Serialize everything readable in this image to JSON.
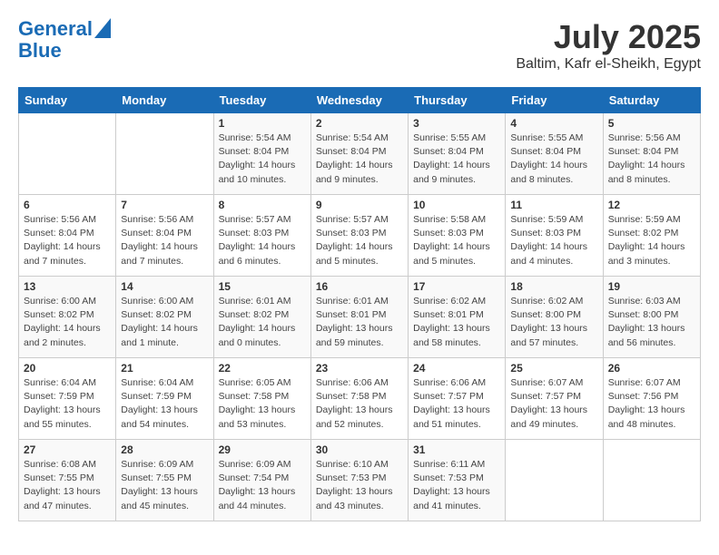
{
  "header": {
    "logo_line1": "General",
    "logo_line2": "Blue",
    "month": "July 2025",
    "location": "Baltim, Kafr el-Sheikh, Egypt"
  },
  "days_of_week": [
    "Sunday",
    "Monday",
    "Tuesday",
    "Wednesday",
    "Thursday",
    "Friday",
    "Saturday"
  ],
  "weeks": [
    [
      {
        "day": "",
        "info": ""
      },
      {
        "day": "",
        "info": ""
      },
      {
        "day": "1",
        "info": "Sunrise: 5:54 AM\nSunset: 8:04 PM\nDaylight: 14 hours\nand 10 minutes."
      },
      {
        "day": "2",
        "info": "Sunrise: 5:54 AM\nSunset: 8:04 PM\nDaylight: 14 hours\nand 9 minutes."
      },
      {
        "day": "3",
        "info": "Sunrise: 5:55 AM\nSunset: 8:04 PM\nDaylight: 14 hours\nand 9 minutes."
      },
      {
        "day": "4",
        "info": "Sunrise: 5:55 AM\nSunset: 8:04 PM\nDaylight: 14 hours\nand 8 minutes."
      },
      {
        "day": "5",
        "info": "Sunrise: 5:56 AM\nSunset: 8:04 PM\nDaylight: 14 hours\nand 8 minutes."
      }
    ],
    [
      {
        "day": "6",
        "info": "Sunrise: 5:56 AM\nSunset: 8:04 PM\nDaylight: 14 hours\nand 7 minutes."
      },
      {
        "day": "7",
        "info": "Sunrise: 5:56 AM\nSunset: 8:04 PM\nDaylight: 14 hours\nand 7 minutes."
      },
      {
        "day": "8",
        "info": "Sunrise: 5:57 AM\nSunset: 8:03 PM\nDaylight: 14 hours\nand 6 minutes."
      },
      {
        "day": "9",
        "info": "Sunrise: 5:57 AM\nSunset: 8:03 PM\nDaylight: 14 hours\nand 5 minutes."
      },
      {
        "day": "10",
        "info": "Sunrise: 5:58 AM\nSunset: 8:03 PM\nDaylight: 14 hours\nand 5 minutes."
      },
      {
        "day": "11",
        "info": "Sunrise: 5:59 AM\nSunset: 8:03 PM\nDaylight: 14 hours\nand 4 minutes."
      },
      {
        "day": "12",
        "info": "Sunrise: 5:59 AM\nSunset: 8:02 PM\nDaylight: 14 hours\nand 3 minutes."
      }
    ],
    [
      {
        "day": "13",
        "info": "Sunrise: 6:00 AM\nSunset: 8:02 PM\nDaylight: 14 hours\nand 2 minutes."
      },
      {
        "day": "14",
        "info": "Sunrise: 6:00 AM\nSunset: 8:02 PM\nDaylight: 14 hours\nand 1 minute."
      },
      {
        "day": "15",
        "info": "Sunrise: 6:01 AM\nSunset: 8:02 PM\nDaylight: 14 hours\nand 0 minutes."
      },
      {
        "day": "16",
        "info": "Sunrise: 6:01 AM\nSunset: 8:01 PM\nDaylight: 13 hours\nand 59 minutes."
      },
      {
        "day": "17",
        "info": "Sunrise: 6:02 AM\nSunset: 8:01 PM\nDaylight: 13 hours\nand 58 minutes."
      },
      {
        "day": "18",
        "info": "Sunrise: 6:02 AM\nSunset: 8:00 PM\nDaylight: 13 hours\nand 57 minutes."
      },
      {
        "day": "19",
        "info": "Sunrise: 6:03 AM\nSunset: 8:00 PM\nDaylight: 13 hours\nand 56 minutes."
      }
    ],
    [
      {
        "day": "20",
        "info": "Sunrise: 6:04 AM\nSunset: 7:59 PM\nDaylight: 13 hours\nand 55 minutes."
      },
      {
        "day": "21",
        "info": "Sunrise: 6:04 AM\nSunset: 7:59 PM\nDaylight: 13 hours\nand 54 minutes."
      },
      {
        "day": "22",
        "info": "Sunrise: 6:05 AM\nSunset: 7:58 PM\nDaylight: 13 hours\nand 53 minutes."
      },
      {
        "day": "23",
        "info": "Sunrise: 6:06 AM\nSunset: 7:58 PM\nDaylight: 13 hours\nand 52 minutes."
      },
      {
        "day": "24",
        "info": "Sunrise: 6:06 AM\nSunset: 7:57 PM\nDaylight: 13 hours\nand 51 minutes."
      },
      {
        "day": "25",
        "info": "Sunrise: 6:07 AM\nSunset: 7:57 PM\nDaylight: 13 hours\nand 49 minutes."
      },
      {
        "day": "26",
        "info": "Sunrise: 6:07 AM\nSunset: 7:56 PM\nDaylight: 13 hours\nand 48 minutes."
      }
    ],
    [
      {
        "day": "27",
        "info": "Sunrise: 6:08 AM\nSunset: 7:55 PM\nDaylight: 13 hours\nand 47 minutes."
      },
      {
        "day": "28",
        "info": "Sunrise: 6:09 AM\nSunset: 7:55 PM\nDaylight: 13 hours\nand 45 minutes."
      },
      {
        "day": "29",
        "info": "Sunrise: 6:09 AM\nSunset: 7:54 PM\nDaylight: 13 hours\nand 44 minutes."
      },
      {
        "day": "30",
        "info": "Sunrise: 6:10 AM\nSunset: 7:53 PM\nDaylight: 13 hours\nand 43 minutes."
      },
      {
        "day": "31",
        "info": "Sunrise: 6:11 AM\nSunset: 7:53 PM\nDaylight: 13 hours\nand 41 minutes."
      },
      {
        "day": "",
        "info": ""
      },
      {
        "day": "",
        "info": ""
      }
    ]
  ]
}
